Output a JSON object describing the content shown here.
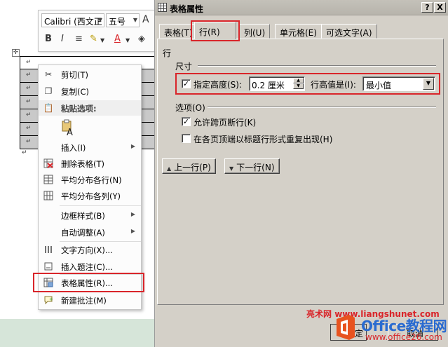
{
  "mini_toolbar": {
    "font_name": "Calibri (西文正",
    "font_size": "五号",
    "grow_font": "A",
    "bold": "B",
    "italic": "I",
    "font_color_letter": "A"
  },
  "context_menu": {
    "items": [
      {
        "label": "剪切(T)",
        "icon": "scissors-icon"
      },
      {
        "label": "复制(C)",
        "icon": "copy-icon"
      },
      {
        "label": "粘贴选项:",
        "icon": "paste-icon"
      },
      {
        "label": "插入(I)",
        "icon": "none"
      },
      {
        "label": "删除表格(T)",
        "icon": "delete-table-icon"
      },
      {
        "label": "平均分布各行(N)",
        "icon": "distribute-rows-icon"
      },
      {
        "label": "平均分布各列(Y)",
        "icon": "distribute-columns-icon"
      },
      {
        "label": "边框样式(B)",
        "icon": "none"
      },
      {
        "label": "自动调整(A)",
        "icon": "none"
      },
      {
        "label": "文字方向(X)...",
        "icon": "text-direction-icon"
      },
      {
        "label": "插入题注(C)...",
        "icon": "insert-caption-icon"
      },
      {
        "label": "表格属性(R)...",
        "icon": "table-properties-icon"
      },
      {
        "label": "新建批注(M)",
        "icon": "new-comment-icon"
      }
    ],
    "paste_letter": "A"
  },
  "dialog": {
    "title": "表格属性",
    "help_btn": "?",
    "close_btn": "X",
    "tabs": [
      {
        "label": "表格(T)"
      },
      {
        "label": "行(R)"
      },
      {
        "label": "列(U)"
      },
      {
        "label": "单元格(E)"
      },
      {
        "label": "可选文字(A)"
      }
    ],
    "row_heading": "行",
    "size_section": "尺寸",
    "specify_height_label": "指定高度(S):",
    "specify_height_checked": true,
    "height_value": "0.2 厘米",
    "row_height_is_label": "行高值是(I):",
    "row_height_mode": "最小值",
    "options_section": "选项(O)",
    "allow_break_label": "允许跨页断行(K)",
    "allow_break_checked": true,
    "repeat_header_label": "在各页顶端以标题行形式重复出现(H)",
    "repeat_header_checked": false,
    "prev_row_btn": "上一行(P)",
    "next_row_btn": "下一行(N)",
    "check_mark": "✓",
    "ok_partial": "定",
    "cancel_btn": "取消"
  },
  "watermark": {
    "site_name": "亮术网",
    "site_url": "www.liangshunet.com",
    "brand": "Office教程网",
    "brand_url": "www.office26.com"
  }
}
